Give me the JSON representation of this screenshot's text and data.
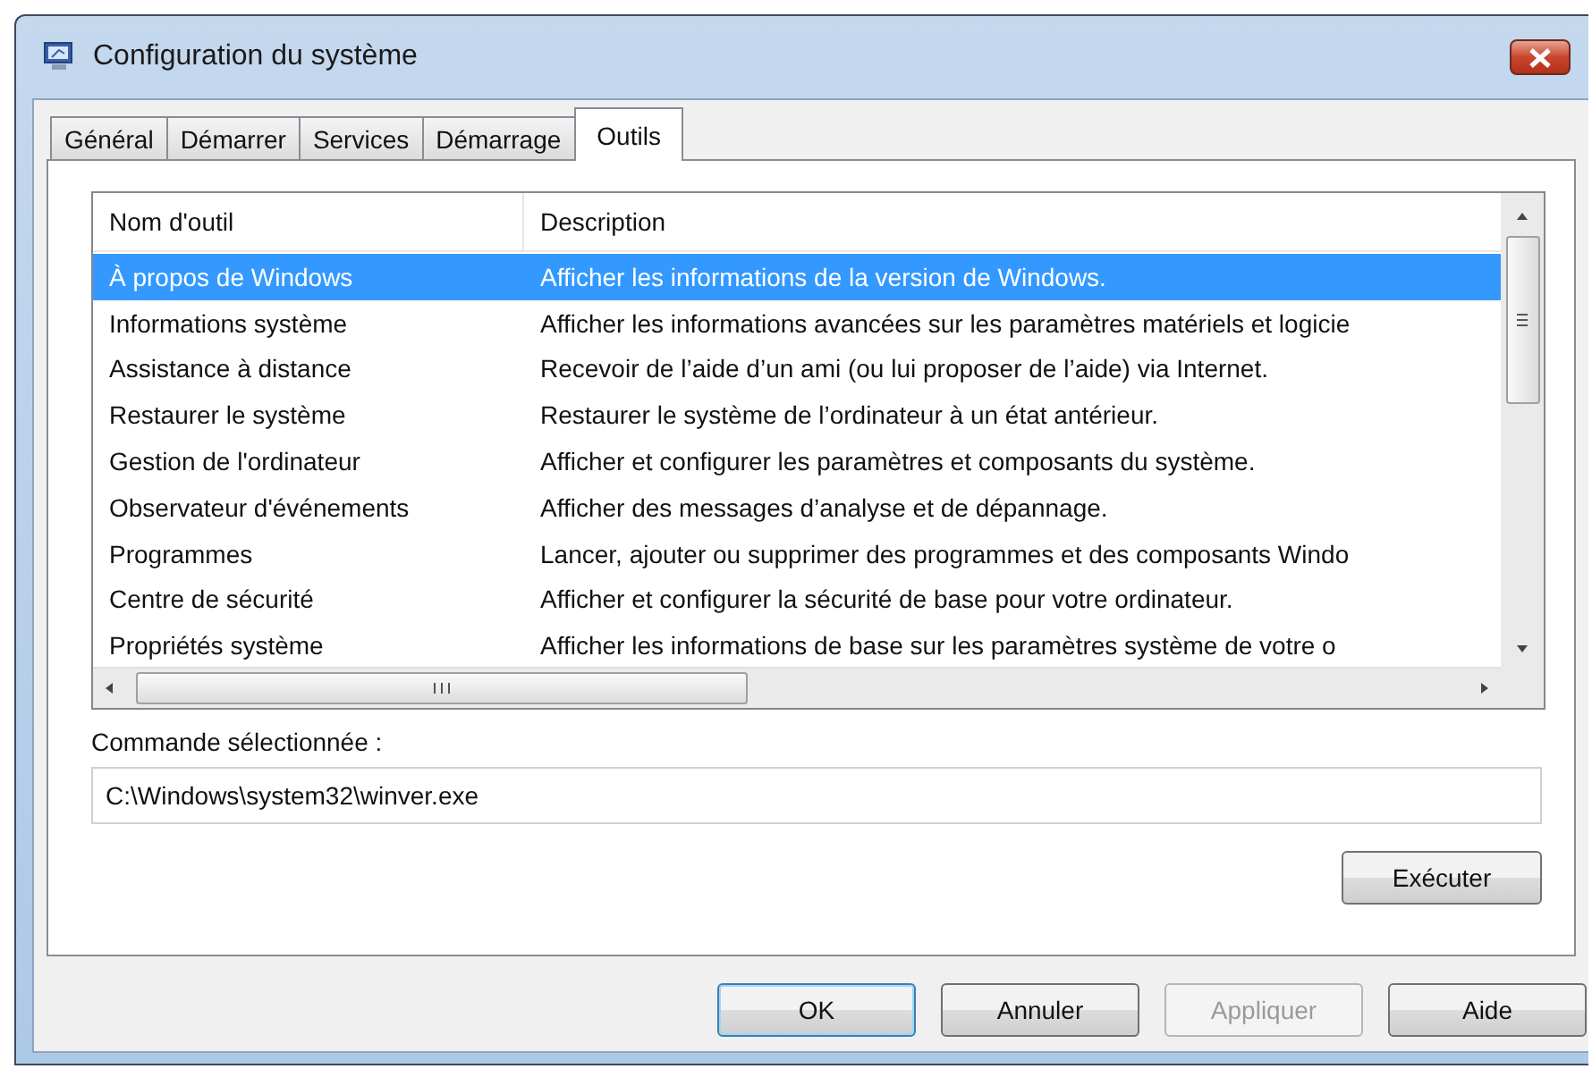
{
  "window": {
    "title": "Configuration du système"
  },
  "tabs": [
    {
      "label": "Général",
      "selected": false
    },
    {
      "label": "Démarrer",
      "selected": false
    },
    {
      "label": "Services",
      "selected": false
    },
    {
      "label": "Démarrage",
      "selected": false
    },
    {
      "label": "Outils",
      "selected": true
    }
  ],
  "table": {
    "columns": [
      "Nom d'outil",
      "Description"
    ],
    "rows": [
      {
        "name": "À propos de Windows",
        "description": "Afficher les informations de la version de Windows.",
        "selected": true
      },
      {
        "name": "Informations système",
        "description": "Afficher les informations avancées sur les paramètres matériels et logicie",
        "selected": false
      },
      {
        "name": "Assistance à distance",
        "description": "Recevoir de l’aide d’un ami (ou lui proposer de l’aide) via Internet.",
        "selected": false
      },
      {
        "name": "Restaurer le système",
        "description": "Restaurer le système de l’ordinateur à un état antérieur.",
        "selected": false
      },
      {
        "name": "Gestion de l'ordinateur",
        "description": "Afficher et configurer les paramètres et composants du système.",
        "selected": false
      },
      {
        "name": "Observateur d'événements",
        "description": "Afficher des messages d’analyse et de dépannage.",
        "selected": false
      },
      {
        "name": "Programmes",
        "description": "Lancer, ajouter ou supprimer des programmes et des composants Windo",
        "selected": false
      },
      {
        "name": "Centre de sécurité",
        "description": "Afficher et configurer la sécurité de base pour votre ordinateur.",
        "selected": false
      },
      {
        "name": "Propriétés système",
        "description": "Afficher les informations de base sur les paramètres système de votre o",
        "selected": false
      }
    ]
  },
  "command": {
    "label": "Commande sélectionnée :",
    "value": "C:\\Windows\\system32\\winver.exe"
  },
  "run_button": "Exécuter",
  "buttons": [
    {
      "label": "OK",
      "default": true,
      "disabled": false
    },
    {
      "label": "Annuler",
      "default": false,
      "disabled": false
    },
    {
      "label": "Appliquer",
      "default": false,
      "disabled": true
    },
    {
      "label": "Aide",
      "default": false,
      "disabled": false
    }
  ]
}
